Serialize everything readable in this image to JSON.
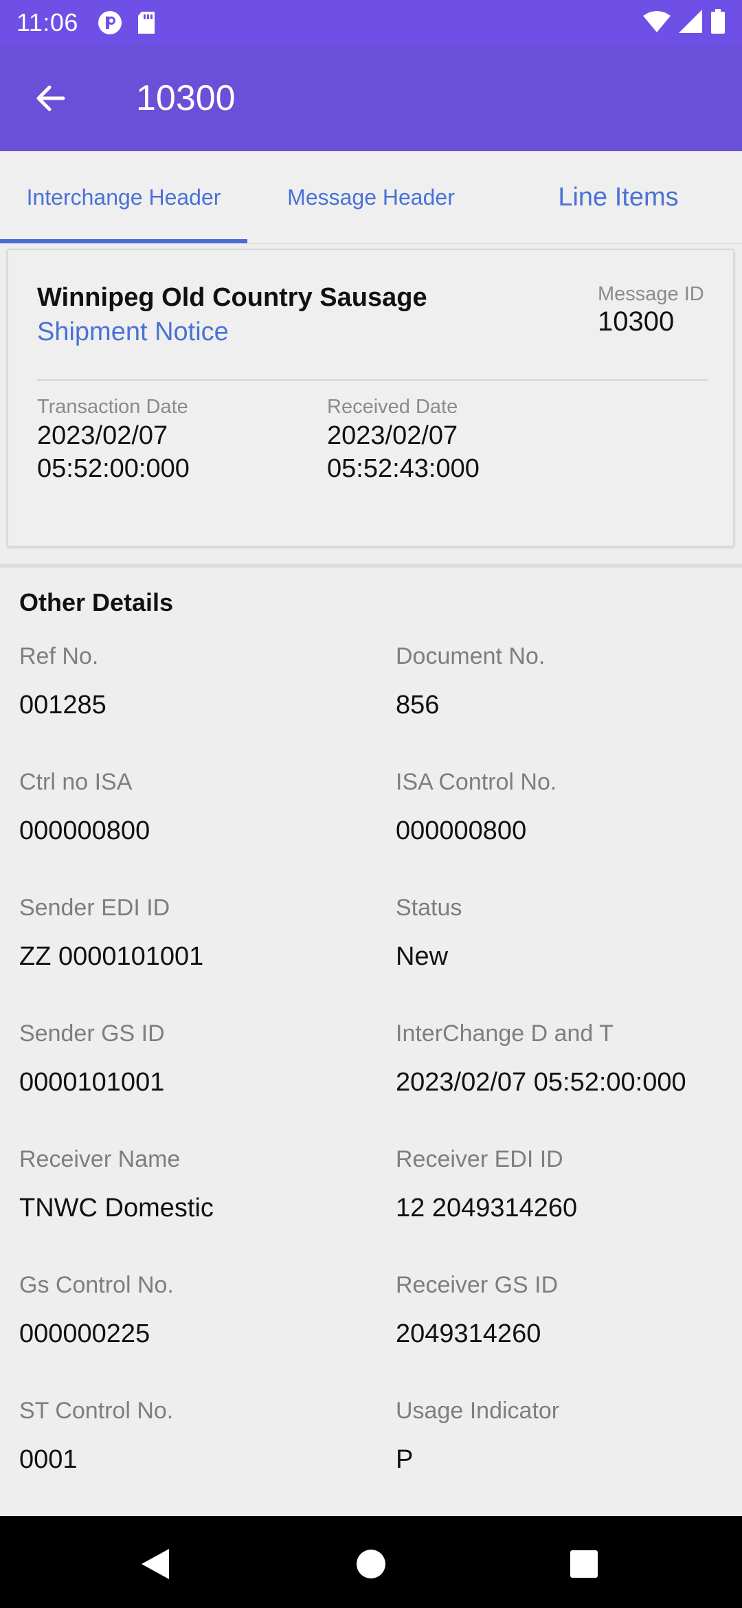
{
  "status_bar": {
    "time": "11:06",
    "icons": [
      "p-icon",
      "sd-card-icon",
      "wifi-icon",
      "signal-icon",
      "battery-icon"
    ]
  },
  "app_bar": {
    "title": "10300",
    "back_icon": "arrow-left-icon"
  },
  "tabs": [
    {
      "label": "Interchange Header",
      "active": true
    },
    {
      "label": "Message Header",
      "active": false
    },
    {
      "label": "Line Items",
      "active": false
    }
  ],
  "summary_card": {
    "company": "Winnipeg Old Country Sausage",
    "document_type": "Shipment Notice",
    "message_id_label": "Message ID",
    "message_id": "10300",
    "transaction_date_label": "Transaction Date",
    "transaction_date": "2023/02/07",
    "transaction_time": "05:52:00:000",
    "received_date_label": "Received Date",
    "received_date": "2023/02/07",
    "received_time": "05:52:43:000"
  },
  "other_details": {
    "heading": "Other Details",
    "fields": [
      {
        "label": "Ref No.",
        "value": "001285"
      },
      {
        "label": "Document No.",
        "value": "856"
      },
      {
        "label": "Ctrl no ISA",
        "value": "000000800"
      },
      {
        "label": "ISA Control No.",
        "value": "000000800"
      },
      {
        "label": "Sender EDI ID",
        "value": "ZZ 0000101001"
      },
      {
        "label": "Status",
        "value": "New"
      },
      {
        "label": "Sender GS ID",
        "value": "0000101001"
      },
      {
        "label": "InterChange D and T",
        "value": "2023/02/07 05:52:00:000"
      },
      {
        "label": "Receiver Name",
        "value": "TNWC Domestic"
      },
      {
        "label": "Receiver EDI ID",
        "value": "12 2049314260"
      },
      {
        "label": "Gs Control No.",
        "value": "000000225"
      },
      {
        "label": "Receiver GS ID",
        "value": "2049314260"
      },
      {
        "label": "ST Control No.",
        "value": "0001"
      },
      {
        "label": "Usage Indicator",
        "value": "P"
      }
    ]
  },
  "nav_bar": {
    "icons": [
      "back-triangle-icon",
      "home-circle-icon",
      "recents-square-icon"
    ]
  },
  "colors": {
    "status_bar": "#6f50e6",
    "app_bar": "#6a4fd9",
    "accent": "#4a72d6"
  }
}
